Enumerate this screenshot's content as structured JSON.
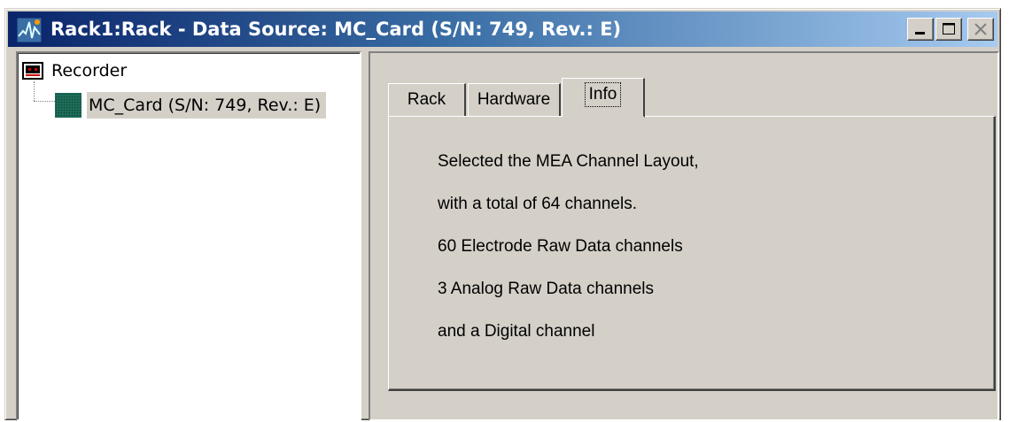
{
  "window": {
    "title": "Rack1:Rack - Data Source: MC_Card (S/N: 749, Rev.: E)",
    "icon": "app-waveform-icon",
    "buttons": [
      "minimize-icon",
      "maximize-icon",
      "close-icon"
    ]
  },
  "tree": {
    "root": {
      "label": "Recorder",
      "icon": "recorder-icon"
    },
    "children": [
      {
        "label": "MC_Card (S/N: 749, Rev.: E)",
        "icon": "card-grid-icon",
        "selected": true
      }
    ]
  },
  "tabs": [
    {
      "label": "Rack",
      "active": false
    },
    {
      "label": "Hardware",
      "active": false
    },
    {
      "label": "Info",
      "active": true
    }
  ],
  "info": {
    "lines": [
      "Selected the MEA Channel Layout,",
      "with a total of 64 channels.",
      "60 Electrode Raw Data channels",
      "3 Analog Raw Data channels",
      "and a Digital channel"
    ]
  },
  "colors": {
    "title_gradient_start": "#0a246a",
    "title_gradient_end": "#a6caf0",
    "face": "#d4d0c8",
    "card_icon": "#1c6b58"
  }
}
